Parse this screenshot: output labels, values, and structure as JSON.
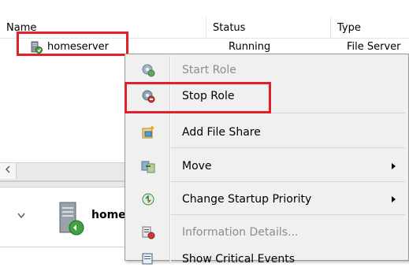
{
  "columns": {
    "name": "Name",
    "status": "Status",
    "type": "Type"
  },
  "row": {
    "name": "homeserver",
    "status": "Running",
    "type": "File Server"
  },
  "menu": {
    "items": [
      {
        "label": "Start Role",
        "icon": "start-role-icon",
        "disabled": true
      },
      {
        "label": "Stop Role",
        "icon": "stop-role-icon",
        "disabled": false
      },
      {
        "label": "Add File Share",
        "icon": "add-file-share-icon",
        "disabled": false
      },
      {
        "label": "Move",
        "icon": "move-icon",
        "disabled": false,
        "submenu": true
      },
      {
        "label": "Change Startup Priority",
        "icon": "priority-icon",
        "disabled": false,
        "submenu": true
      },
      {
        "label": "Information Details...",
        "icon": "information-details-icon",
        "disabled": true
      },
      {
        "label": "Show Critical Events",
        "icon": "critical-events-icon",
        "disabled": false
      }
    ]
  },
  "detail": {
    "title": "homeserver"
  },
  "colors": {
    "highlight_border": "#e0202a",
    "menu_background": "#f0f0f0",
    "disabled_text": "#8d8d8d"
  }
}
